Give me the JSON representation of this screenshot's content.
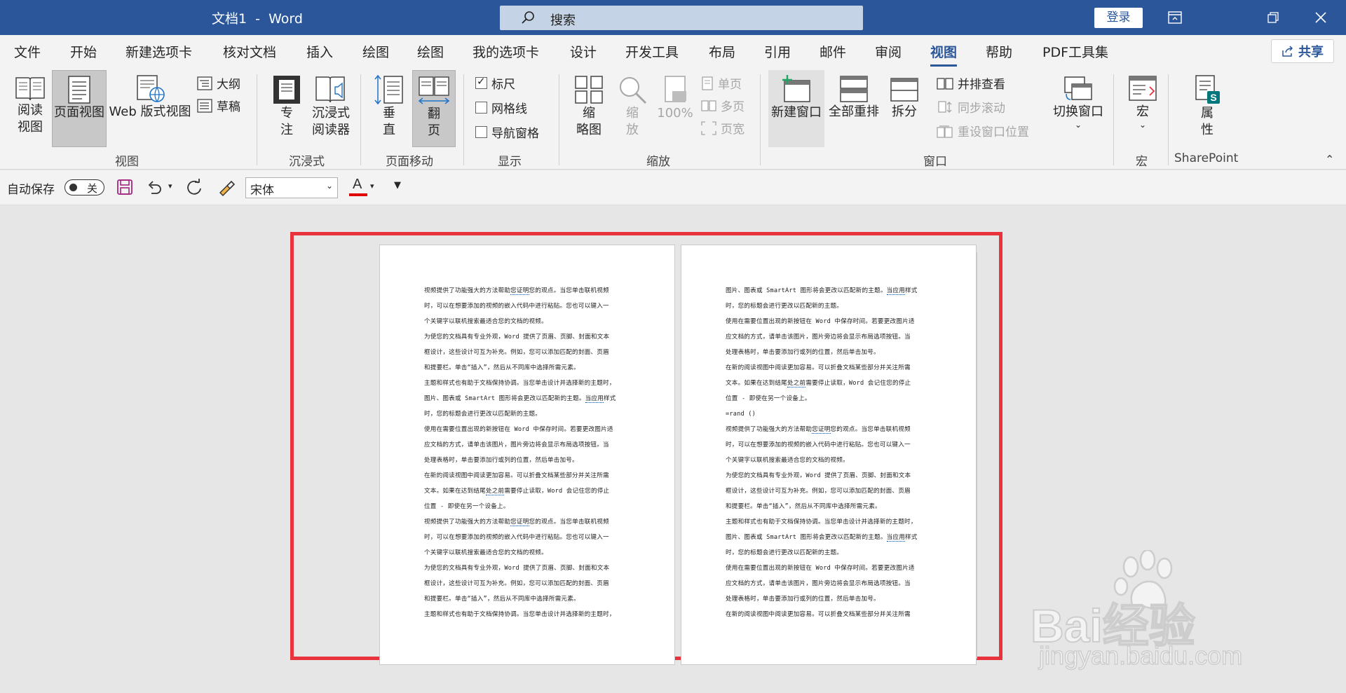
{
  "window": {
    "title": "文档1  -  Word",
    "search_placeholder": "搜索",
    "login_label": "登录",
    "accent": "#2b579a"
  },
  "tabs": [
    "文件",
    "开始",
    "新建选项卡",
    "核对文档",
    "插入",
    "绘图",
    "绘图",
    "我的选项卡",
    "设计",
    "开发工具",
    "布局",
    "引用",
    "邮件",
    "审阅",
    "视图",
    "帮助",
    "PDF工具集"
  ],
  "active_tab": "视图",
  "share_label": "共享",
  "ribbon": {
    "views": {
      "label": "视图",
      "read_mode": "阅读\n视图",
      "print_layout": "页面视图",
      "web_layout": "Web 版式视图",
      "outline": "大纲",
      "draft": "草稿"
    },
    "immersive": {
      "label": "沉浸式",
      "focus": "专\n注",
      "immersive_reader": "沉浸式\n阅读器"
    },
    "page_movement": {
      "label": "页面移动",
      "vertical": "垂\n直",
      "side_to_side": "翻\n页"
    },
    "show": {
      "label": "显示",
      "ruler": "标尺",
      "ruler_checked": true,
      "gridlines": "网格线",
      "gridlines_checked": false,
      "nav_pane": "导航窗格",
      "nav_pane_checked": false
    },
    "zoom": {
      "label": "缩放",
      "thumbnails": "缩\n略图",
      "zoom": "缩\n放",
      "hundred": "100%",
      "one_page": "单页",
      "multiple_pages": "多页",
      "page_width": "页宽"
    },
    "window": {
      "label": "窗口",
      "new_window": "新建窗口",
      "arrange_all": "全部重排",
      "split": "拆分",
      "side_by_side": "并排查看",
      "sync_scroll": "同步滚动",
      "reset_position": "重设窗口位置",
      "switch_windows": "切换窗口"
    },
    "macros": {
      "label": "宏",
      "macros_btn": "宏"
    },
    "sharepoint": {
      "label": "SharePoint",
      "properties": "属\n性"
    }
  },
  "qat": {
    "autosave_label": "自动保存",
    "toggle_state": "关",
    "font_name": "宋体"
  },
  "document": {
    "page1_lines": [
      [
        "视频提供了功能强大的方法帮助",
        "您证明",
        "您的观点。当您单击联机视频"
      ],
      [
        "时，可以在想要添加的视频的嵌入代码中进行粘贴。您也可以键入一"
      ],
      [
        "个关键字以联机搜索最适合您的文档的视频。"
      ],
      [
        "为使您的文档具有专业外观，Word 提供了页眉、页脚、封面和文本"
      ],
      [
        "框设计，这些设计可互为补充。例如，您可以添加匹配的封面、页眉"
      ],
      [
        "和提要栏。单击“插入”，然后从不同库中选择所需元素。"
      ],
      [
        "主题和样式也有助于文档保持协调。当您单击设计并选择新的主题时，"
      ],
      [
        "图片、图表或 SmartArt 图形将会更改以匹配新的主题。",
        "当应用",
        "样式"
      ],
      [
        "时，您的标题会进行更改以匹配新的主题。"
      ],
      [
        "使用在需要位置出现的新按钮在 Word 中保存时间。若要更改图片适"
      ],
      [
        "应文档的方式，请单击该图片，图片旁边将会显示布局选项按钮。当"
      ],
      [
        "处理表格时，单击要添加行或列的位置，然后单击加号。"
      ],
      [
        "在新的阅读视图中阅读更加容易。可以折叠文档某些部分并关注所需"
      ],
      [
        "文本。如果在达到结尾",
        "处之前",
        "需要停止读取，Word 会记住您的停止"
      ],
      [
        "位置 - 即使在另一个设备上。"
      ],
      [
        "视频提供了功能强大的方法帮助",
        "您证明",
        "您的观点。当您单击联机视频"
      ],
      [
        "时，可以在想要添加的视频的嵌入代码中进行粘贴。您也可以键入一"
      ],
      [
        "个关键字以联机搜索最适合您的文档的视频。"
      ],
      [
        "为使您的文档具有专业外观，Word 提供了页眉、页脚、封面和文本"
      ],
      [
        "框设计，这些设计可互为补充。例如，您可以添加匹配的封面、页眉"
      ],
      [
        "和提要栏。单击“插入”，然后从不同库中选择所需元素。"
      ],
      [
        "主题和样式也有助于文档保持协调。当您单击设计并选择新的主题时，"
      ]
    ],
    "page2_lines": [
      [
        "图片、图表或 SmartArt 图形将会更改以匹配新的主题。",
        "当应用",
        "样式"
      ],
      [
        "时，您的标题会进行更改以匹配新的主题。"
      ],
      [
        "使用在需要位置出现的新按钮在 Word 中保存时间。若要更改图片适"
      ],
      [
        "应文档的方式，请单击该图片，图片旁边将会显示布局选项按钮。当"
      ],
      [
        "处理表格时，单击要添加行或列的位置，然后单击加号。"
      ],
      [
        "在新的阅读视图中阅读更加容易。可以折叠文档某些部分并关注所需"
      ],
      [
        "文本。如果在达到结尾",
        "处之前",
        "需要停止读取，Word 会记住您的停止"
      ],
      [
        "位置 - 即使在另一个设备上。"
      ],
      [
        "=rand ()"
      ],
      [
        "视频提供了功能强大的方法帮助",
        "您证明",
        "您的观点。当您单击联机视频"
      ],
      [
        "时，可以在想要添加的视频的嵌入代码中进行粘贴。您也可以键入一"
      ],
      [
        "个关键字以联机搜索最适合您的文档的视频。"
      ],
      [
        "为使您的文档具有专业外观，Word 提供了页眉、页脚、封面和文本"
      ],
      [
        "框设计，这些设计可互为补充。例如，您可以添加匹配的封面、页眉"
      ],
      [
        "和提要栏。单击“插入”，然后从不同库中选择所需元素。"
      ],
      [
        "主题和样式也有助于文档保持协调。当您单击设计并选择新的主题时，"
      ],
      [
        "图片、图表或 SmartArt 图形将会更改以匹配新的主题。",
        "当应用",
        "样式"
      ],
      [
        "时，您的标题会进行更改以匹配新的主题。"
      ],
      [
        "使用在需要位置出现的新按钮在 Word 中保存时间。若要更改图片适"
      ],
      [
        "应文档的方式，请单击该图片，图片旁边将会显示布局选项按钮。当"
      ],
      [
        "处理表格时，单击要添加行或列的位置，然后单击加号。"
      ],
      [
        "在新的阅读视图中阅读更加容易。可以折叠文档某些部分并关注所需"
      ]
    ],
    "highlight_color": "#e8323c"
  },
  "watermark": {
    "brand": "Bai经验",
    "url": "jingyan.baidu.com"
  }
}
